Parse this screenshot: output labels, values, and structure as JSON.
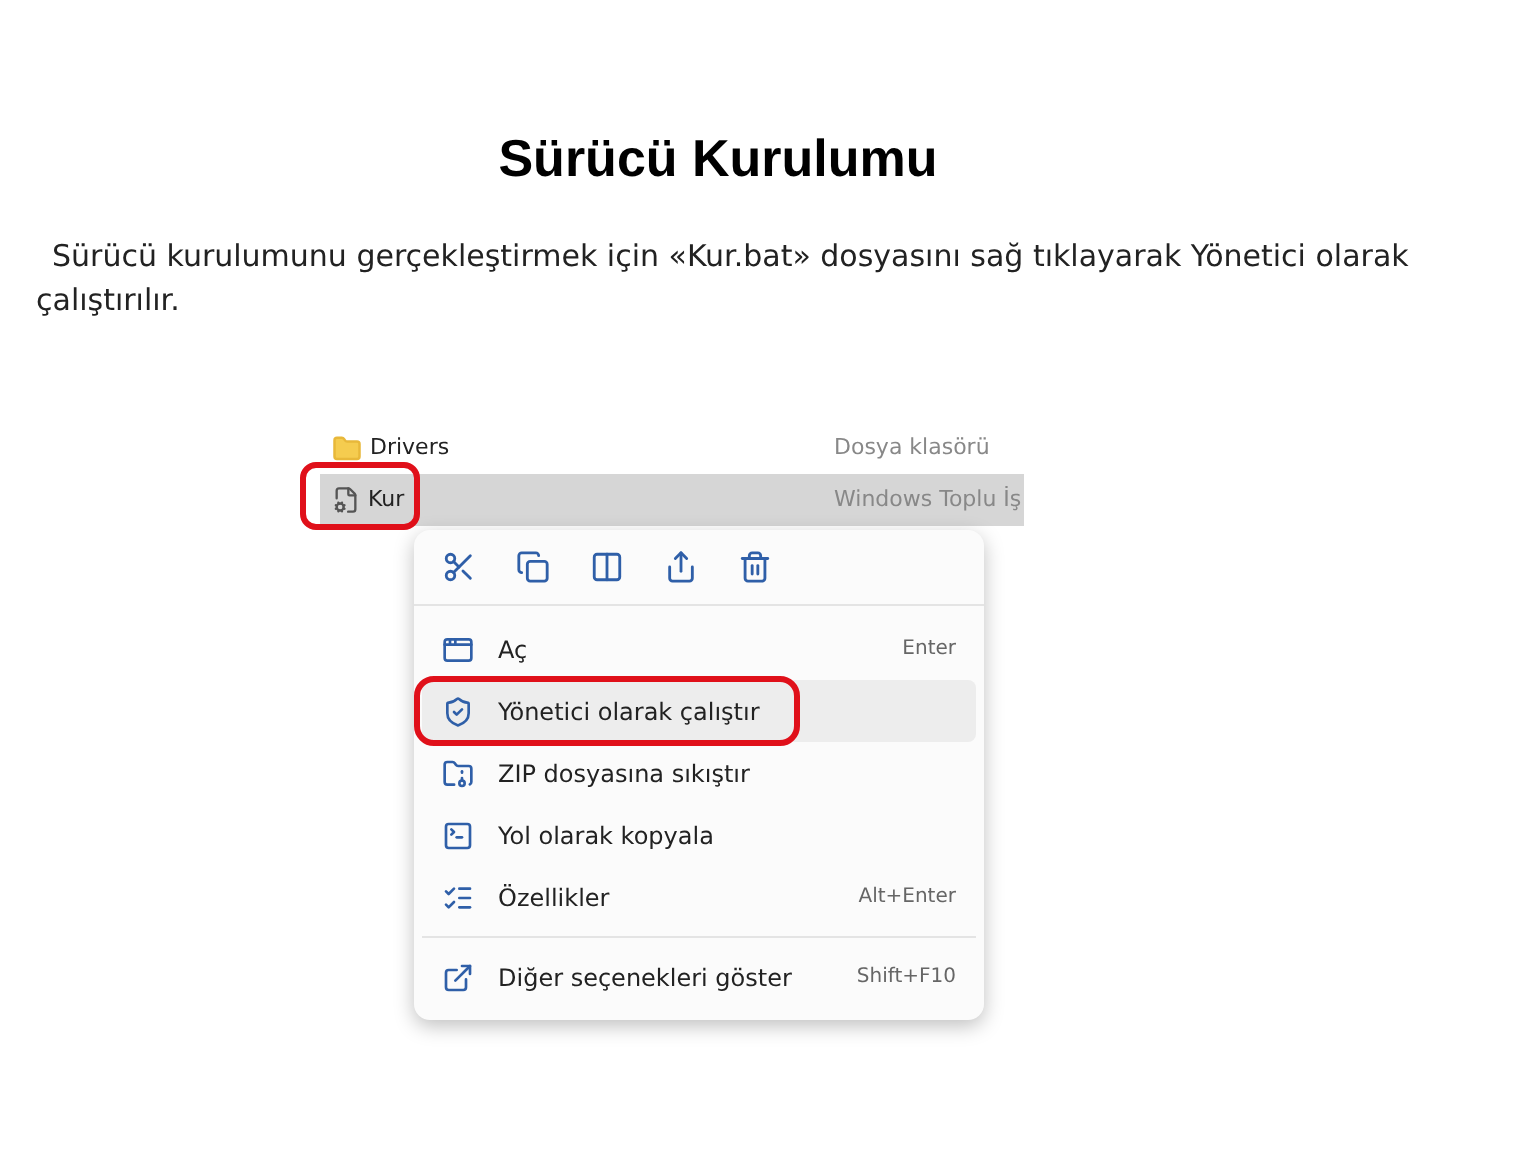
{
  "title": "Sürücü Kurulumu",
  "paragraph": "Sürücü kurulumunu gerçekleştirmek için «Kur.bat» dosyasını sağ tıklayarak Yönetici olarak çalıştırılır.",
  "explorer": {
    "files": [
      {
        "kind": "folder",
        "name": "Drivers",
        "type": "Dosya klasörü",
        "selected": false,
        "annotated": false
      },
      {
        "kind": "batch",
        "name": "Kur",
        "type": "Windows Toplu İş",
        "selected": true,
        "annotated": true
      }
    ]
  },
  "context_menu": {
    "items": [
      {
        "kind": "open",
        "label": "Aç",
        "shortcut": "Enter",
        "selected": false,
        "annotated": false
      },
      {
        "kind": "admin",
        "label": "Yönetici olarak çalıştır",
        "selected": true,
        "annotated": true
      },
      {
        "kind": "zip",
        "label": "ZIP dosyasına sıkıştır",
        "selected": false,
        "annotated": false
      },
      {
        "kind": "path",
        "label": "Yol olarak kopyala",
        "selected": false,
        "annotated": false
      },
      {
        "kind": "properties",
        "label": "Özellikler",
        "shortcut": "Alt+Enter",
        "selected": false,
        "annotated": false
      },
      {
        "kind": "more",
        "label": "Diğer seçenekleri göster",
        "shortcut": "Shift+F10",
        "selected": false,
        "annotated": false,
        "divider_before": true
      }
    ]
  }
}
